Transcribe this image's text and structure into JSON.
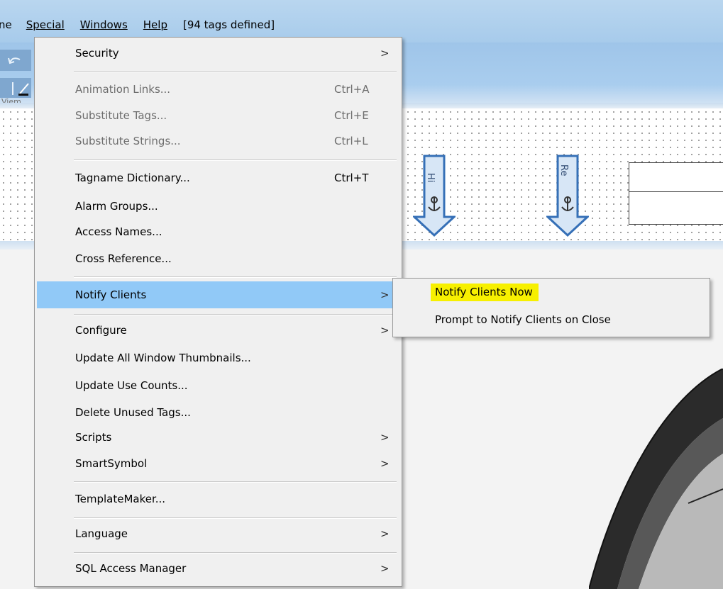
{
  "menubar": {
    "items": [
      "ne",
      "Special",
      "Windows",
      "Help"
    ],
    "tags_status": "[94 tags defined]"
  },
  "toolbar": {
    "truncated_label": "Viem"
  },
  "canvas": {
    "arrow1_label": "Hi",
    "arrow2_label": "Re"
  },
  "special_menu": {
    "items": [
      {
        "label": "Security",
        "shortcut": "",
        "submenu": ">"
      },
      {
        "label": "Animation Links...",
        "shortcut": "Ctrl+A"
      },
      {
        "label": "Substitute Tags...",
        "shortcut": "Ctrl+E"
      },
      {
        "label": "Substitute Strings...",
        "shortcut": "Ctrl+L"
      },
      {
        "label": "Tagname Dictionary...",
        "shortcut": "Ctrl+T"
      },
      {
        "label": "Alarm Groups..."
      },
      {
        "label": "Access Names..."
      },
      {
        "label": "Cross Reference..."
      },
      {
        "label": "Notify Clients",
        "submenu": ">"
      },
      {
        "label": "Configure",
        "submenu": ">"
      },
      {
        "label": "Update All Window Thumbnails..."
      },
      {
        "label": "Update Use Counts..."
      },
      {
        "label": "Delete Unused Tags..."
      },
      {
        "label": "Scripts",
        "submenu": ">"
      },
      {
        "label": "SmartSymbol",
        "submenu": ">"
      },
      {
        "label": "TemplateMaker..."
      },
      {
        "label": "Language",
        "submenu": ">"
      },
      {
        "label": "SQL Access Manager",
        "submenu": ">"
      }
    ]
  },
  "notify_submenu": {
    "items": [
      {
        "label": "Notify Clients Now"
      },
      {
        "label": "Prompt to Notify Clients on Close"
      }
    ],
    "highlight_color": "#f7f000"
  },
  "colors": {
    "menu_bg": "#f0f0f0",
    "menu_highlight": "#91c9f7",
    "title_band": "#b9d6ef"
  }
}
